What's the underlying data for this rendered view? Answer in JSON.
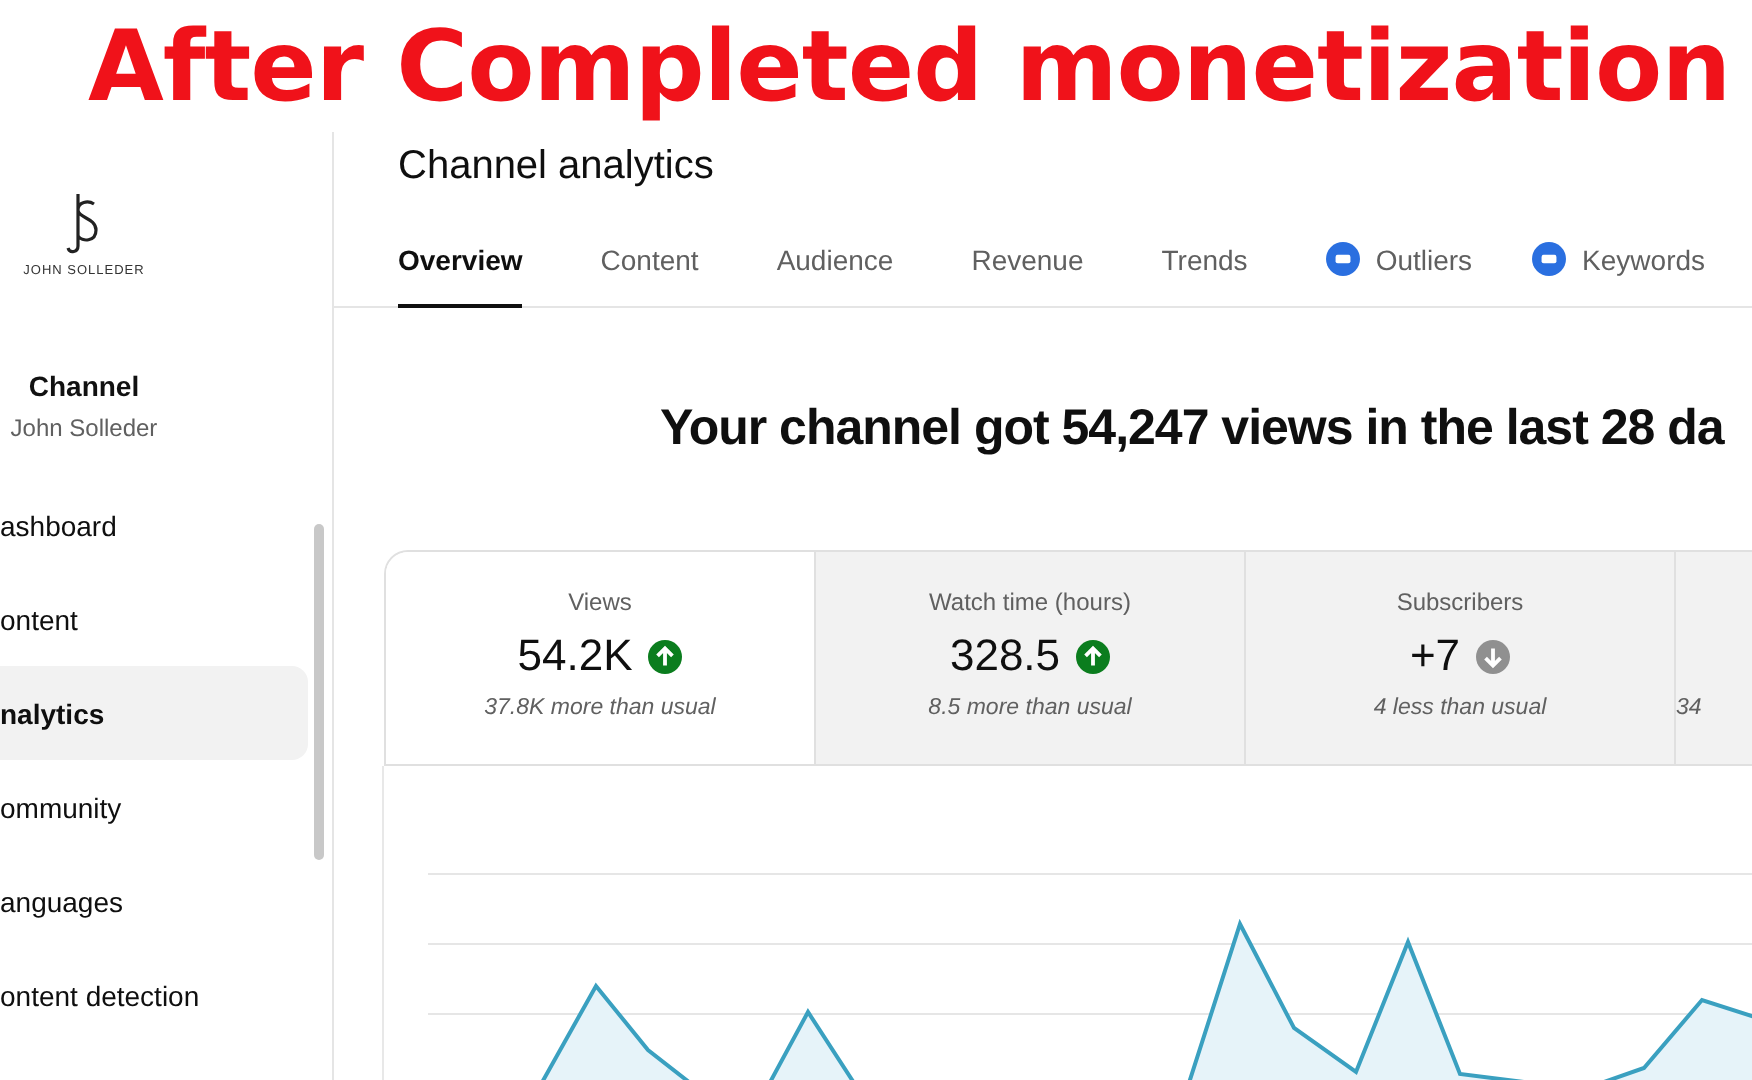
{
  "banner": {
    "title": "After Completed monetization"
  },
  "sidebar": {
    "logo_text": "JOHN SOLLEDER",
    "channel_label": "Channel",
    "channel_name": "John Solleder",
    "items": [
      {
        "label": "ashboard",
        "selected": false
      },
      {
        "label": "ontent",
        "selected": false
      },
      {
        "label": "nalytics",
        "selected": true
      },
      {
        "label": "ommunity",
        "selected": false
      },
      {
        "label": "anguages",
        "selected": false
      },
      {
        "label": "ontent detection",
        "selected": false
      }
    ]
  },
  "page": {
    "title": "Channel analytics"
  },
  "tabs": [
    {
      "label": "Overview",
      "selected": true,
      "kind": "plain"
    },
    {
      "label": "Content",
      "selected": false,
      "kind": "plain"
    },
    {
      "label": "Audience",
      "selected": false,
      "kind": "plain"
    },
    {
      "label": "Revenue",
      "selected": false,
      "kind": "plain"
    },
    {
      "label": "Trends",
      "selected": false,
      "kind": "plain"
    },
    {
      "label": "Outliers",
      "selected": false,
      "kind": "extension"
    },
    {
      "label": "Keywords",
      "selected": false,
      "kind": "extension"
    }
  ],
  "headline": "Your channel got 54,247 views in the last 28 da",
  "metrics": [
    {
      "label": "Views",
      "value": "54.2K",
      "up": true,
      "note": "37.8K more than usual",
      "selected": true
    },
    {
      "label": "Watch time (hours)",
      "value": "328.5",
      "up": true,
      "note": "8.5 more than usual",
      "selected": false
    },
    {
      "label": "Subscribers",
      "value": "+7",
      "up": false,
      "note": "4 less than usual",
      "selected": false
    },
    {
      "note": "34",
      "selected": false
    }
  ]
}
